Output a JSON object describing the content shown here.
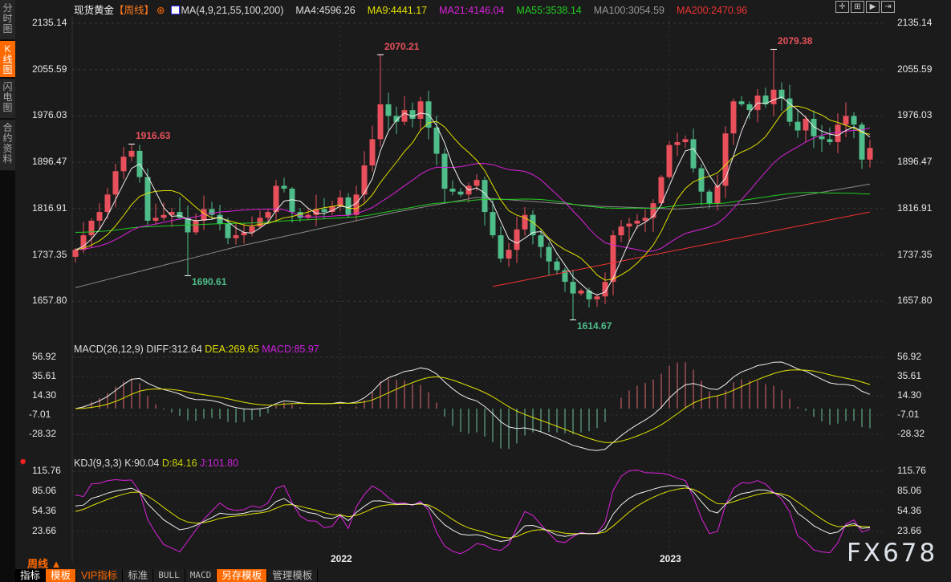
{
  "sidebar": {
    "tabs": [
      {
        "label": "分时图",
        "active": false
      },
      {
        "label": "K线图",
        "active": true
      },
      {
        "label": "闪电图",
        "active": false
      },
      {
        "label": "合约资料",
        "active": false
      }
    ]
  },
  "header": {
    "instrument": "现货黄金",
    "period": "【周线】",
    "ma_label": "MA(4,9,21,55,100,200)",
    "ma": [
      {
        "text": "MA4:4596.26",
        "color": "#dddddd"
      },
      {
        "text": "MA9:4441.17",
        "color": "#e0e000"
      },
      {
        "text": "MA21:4146.04",
        "color": "#dd22dd"
      },
      {
        "text": "MA55:3538.14",
        "color": "#22cc22"
      },
      {
        "text": "MA100:3054.59",
        "color": "#999999"
      },
      {
        "text": "MA200:2470.96",
        "color": "#ee3333"
      }
    ]
  },
  "top_tools": [
    "crosshair-icon",
    "zoom-in-icon",
    "play-icon",
    "exit-icon"
  ],
  "colors": {
    "up": "#e8505b",
    "down": "#4fbd8a",
    "bg": "#1b1b1b",
    "accent": "#ff6a00"
  },
  "chart_data": [
    {
      "type": "candlestick",
      "price_axis": [
        "2135.14",
        "2055.59",
        "1976.03",
        "1896.47",
        "1816.91",
        "1737.35",
        "1657.80"
      ],
      "x_ticks": [
        {
          "label": "2022",
          "index": 33
        },
        {
          "label": "2023",
          "index": 74
        }
      ],
      "closes": [
        1735,
        1760,
        1785,
        1800,
        1830,
        1870,
        1895,
        1905,
        1860,
        1785,
        1790,
        1795,
        1800,
        1790,
        1765,
        1785,
        1805,
        1795,
        1780,
        1755,
        1760,
        1765,
        1775,
        1790,
        1800,
        1845,
        1840,
        1800,
        1790,
        1795,
        1805,
        1800,
        1810,
        1825,
        1795,
        1830,
        1880,
        1925,
        1985,
        1965,
        1955,
        1975,
        1960,
        1990,
        1945,
        1900,
        1840,
        1835,
        1830,
        1845,
        1855,
        1800,
        1760,
        1720,
        1735,
        1770,
        1795,
        1760,
        1740,
        1715,
        1700,
        1680,
        1660,
        1665,
        1650,
        1655,
        1680,
        1760,
        1775,
        1780,
        1785,
        1790,
        1815,
        1860,
        1915,
        1920,
        1925,
        1875,
        1835,
        1815,
        1845,
        1935,
        1990,
        1985,
        1975,
        2000,
        1985,
        2010,
        1995,
        1955,
        1940,
        1960,
        1930,
        1925,
        1920,
        1950,
        1965,
        1950,
        1890,
        1910
      ],
      "annotations": [
        {
          "index": 7,
          "type": "high",
          "value": "1916.63"
        },
        {
          "index": 14,
          "type": "low",
          "value": "1690.61"
        },
        {
          "index": 38,
          "type": "high",
          "value": "2070.21"
        },
        {
          "index": 62,
          "type": "low",
          "value": "1614.67"
        },
        {
          "index": 87,
          "type": "high",
          "value": "2079.38"
        }
      ],
      "ma100": [
        [
          0,
          1670
        ],
        [
          20,
          1740
        ],
        [
          40,
          1800
        ],
        [
          50,
          1825
        ],
        [
          65,
          1810
        ],
        [
          75,
          1805
        ],
        [
          85,
          1815
        ],
        [
          99,
          1848
        ]
      ],
      "ma200": [
        [
          52,
          1672
        ],
        [
          99,
          1800
        ]
      ]
    },
    {
      "type": "macd",
      "title": "MACD(26,12,9)",
      "diff": "DIFF:312.64",
      "dea": "DEA:269.65",
      "macd": "MACD:85.97",
      "axis": [
        "56.92",
        "35.61",
        "14.30",
        "-7.01",
        "-28.32"
      ]
    },
    {
      "type": "kdj",
      "title": "KDJ(9,3,3)",
      "k": "K:90.04",
      "d": "D:84.16",
      "j": "J:101.80",
      "axis": [
        "115.76",
        "85.06",
        "54.36",
        "23.66"
      ]
    }
  ],
  "period_label": "周线 ▲",
  "toolbar": [
    "指标",
    "模板",
    "VIP指标",
    "标准",
    "BULL",
    "MACD",
    "另存模板",
    "管理模板"
  ],
  "watermark": "FX678"
}
